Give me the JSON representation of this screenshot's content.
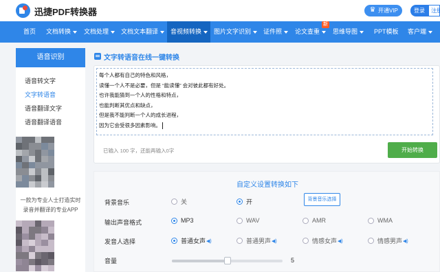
{
  "header": {
    "logo_text": "迅捷PDF转换器",
    "vip_label": "开通VIP",
    "login_label": "登录",
    "register_label": "注册"
  },
  "nav": {
    "items": [
      {
        "label": "首页",
        "dropdown": false
      },
      {
        "label": "文档转换",
        "dropdown": true
      },
      {
        "label": "文档处理",
        "dropdown": true
      },
      {
        "label": "文档文本翻译",
        "dropdown": true
      },
      {
        "label": "音视频转换",
        "dropdown": true
      },
      {
        "label": "图片文字识别",
        "dropdown": true
      },
      {
        "label": "证件照",
        "dropdown": true
      },
      {
        "label": "论文查重",
        "dropdown": true
      },
      {
        "label": "思维导图",
        "dropdown": true
      },
      {
        "label": "PPT模板",
        "dropdown": false
      },
      {
        "label": "客户端",
        "dropdown": true
      }
    ],
    "active_index": 4,
    "new_badge": "新"
  },
  "sidebar": {
    "heading": "语音识别",
    "items": [
      "语音转文字",
      "文字转语音",
      "语音翻译文字",
      "语音翻译语音"
    ],
    "active_index": 1,
    "ad_caption_line1": "一款为专业人士打造实时",
    "ad_caption_line2": "录音并翻译的专业APP"
  },
  "main": {
    "title": "文字转语音在线一键转换",
    "editor_lines": [
      "每个人都有自己的特色和风格，",
      "读懂一个人不是必要，但是 “能读懂” 会对彼此都有好处。",
      "也许我能猜到一个人的性格和特点，",
      "也能判断其优点和缺点，",
      "但是我不能判断一个人的成长进程，",
      "因为它会受很多因素影响。"
    ],
    "count_text": "已输入 100 字，还能再输入0字",
    "start_button": "开始转换"
  },
  "settings": {
    "title": "自定义设置转换如下",
    "bgm": {
      "label": "背景音乐",
      "options": [
        "关",
        "开"
      ],
      "selected": 1,
      "choose_button": "背景音乐选择"
    },
    "format": {
      "label": "输出声音格式",
      "options": [
        "MP3",
        "WAV",
        "AMR",
        "WMA"
      ],
      "selected": 0
    },
    "voice": {
      "label": "发音人选择",
      "options": [
        "普通女声",
        "普通男声",
        "情感女声",
        "情感男声"
      ],
      "selected": 0,
      "speaker_icon": "speaker-icon"
    },
    "volume": {
      "label": "音量",
      "value": "5",
      "level_fraction": 0.5
    }
  }
}
